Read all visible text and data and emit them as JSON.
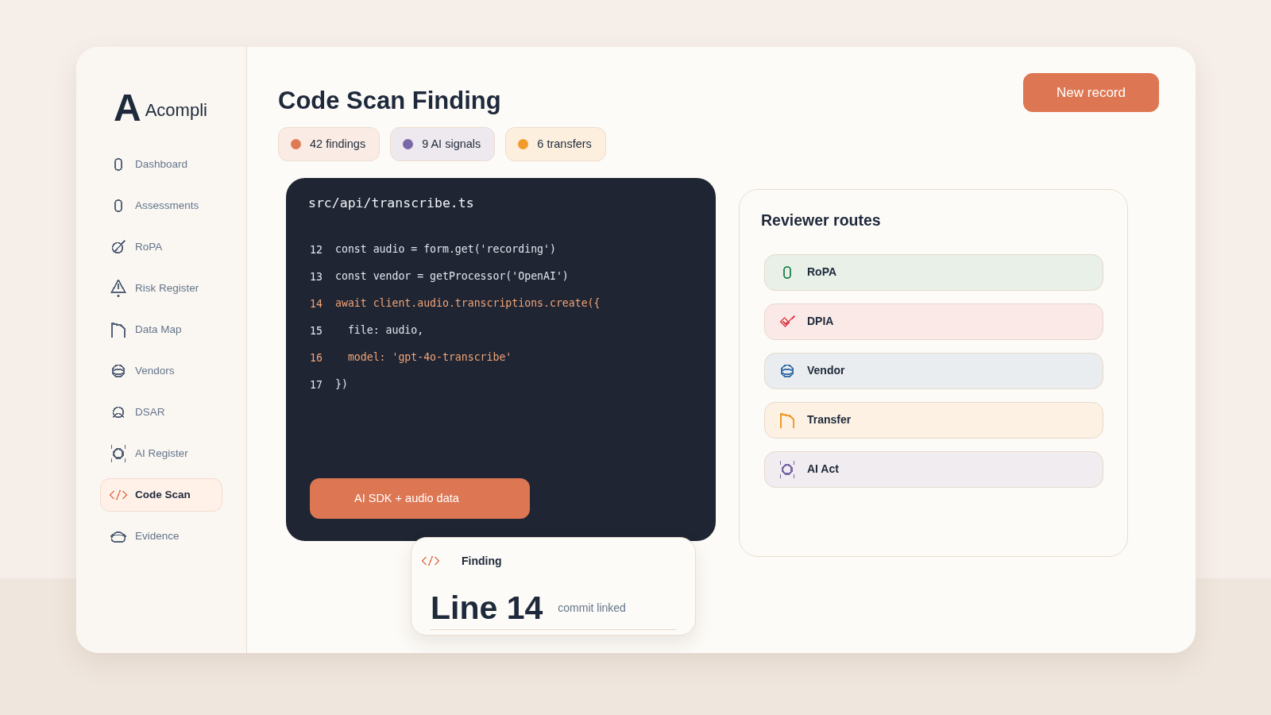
{
  "sidebar": {
    "logo_mark": "A",
    "brand": "Acompli",
    "items": [
      {
        "label": "Dashboard",
        "selected": false
      },
      {
        "label": "Assessments",
        "selected": false
      },
      {
        "label": "RoPA",
        "selected": false
      },
      {
        "label": "Risk Register",
        "selected": false
      },
      {
        "label": "Data Map",
        "selected": false
      },
      {
        "label": "Vendors",
        "selected": false
      },
      {
        "label": "DSAR",
        "selected": false
      },
      {
        "label": "AI Register",
        "selected": false
      },
      {
        "label": "Code Scan",
        "selected": true
      },
      {
        "label": "Evidence",
        "selected": false
      }
    ]
  },
  "header": {
    "title": "Code Scan Finding",
    "action": "New record"
  },
  "chips": [
    {
      "label": "42 findings",
      "color": "#e07a55"
    },
    {
      "label": "9 AI signals",
      "color": "#7b68a8"
    },
    {
      "label": "6 transfers",
      "color": "#f39b2a"
    }
  ],
  "code_panel": {
    "filename": "src/api/transcribe.ts",
    "lines": [
      {
        "number": "12",
        "code": "const audio = form.get('recording')",
        "highlighted": false
      },
      {
        "number": "13",
        "code": "const vendor = getProcessor('OpenAI')",
        "highlighted": false
      },
      {
        "number": "14",
        "code": "await client.audio.transcriptions.create({",
        "highlighted": true
      },
      {
        "number": "15",
        "code": "  file: audio,",
        "highlighted": false
      },
      {
        "number": "16",
        "code": "  model: 'gpt-4o-transcribe'",
        "highlighted": true
      },
      {
        "number": "17",
        "code": "})",
        "highlighted": false
      }
    ],
    "tag": "AI SDK + audio data"
  },
  "finding_card": {
    "label": "Finding",
    "value": "Line 14",
    "note": "commit linked"
  },
  "reviewer_routes": {
    "title": "Reviewer routes",
    "routes": [
      {
        "label": "RoPA",
        "color": "#2e8b5e"
      },
      {
        "label": "DPIA",
        "color": "#e0454f"
      },
      {
        "label": "Vendor",
        "color": "#3a6fa8"
      },
      {
        "label": "Transfer",
        "color": "#f39b2a"
      },
      {
        "label": "AI Act",
        "color": "#7b68a8"
      }
    ]
  }
}
